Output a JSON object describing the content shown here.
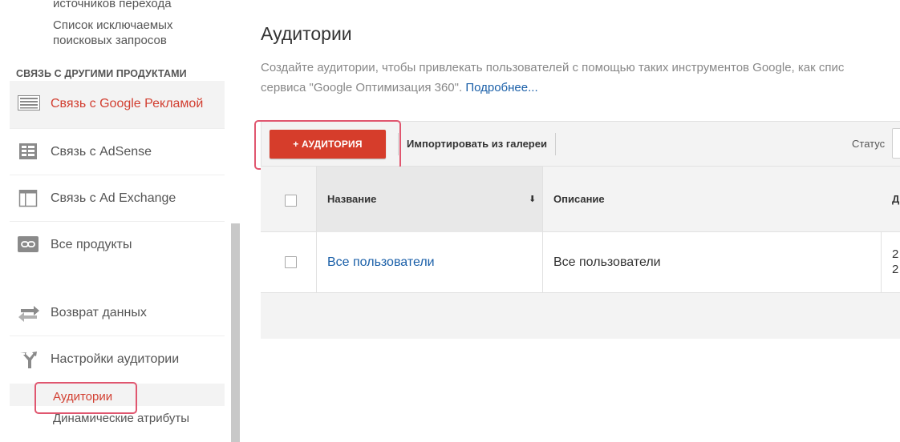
{
  "sidebar": {
    "top_cut_item": "источников перехода",
    "excluded_queries_line1": "Список исключаемых",
    "excluded_queries_line2": "поисковых запросов",
    "section_heading": "СВЯЗЬ С ДРУГИМИ ПРОДУКТАМИ",
    "items": [
      {
        "label": "Связь с Google Рекламой",
        "icon": "google-ads-icon",
        "active": true
      },
      {
        "label": "Связь с AdSense",
        "icon": "adsense-icon",
        "active": false
      },
      {
        "label": "Связь с Ad Exchange",
        "icon": "ad-exchange-icon",
        "active": false
      },
      {
        "label": "Все продукты",
        "icon": "link-icon",
        "active": false
      },
      {
        "label": "Возврат данных",
        "icon": "data-return-icon",
        "active": false
      },
      {
        "label": "Настройки аудитории",
        "icon": "audience-settings-icon",
        "active": false
      }
    ],
    "sub_audiences": "Аудитории",
    "sub_dynamic_attributes": "Динамические атрибуты"
  },
  "main": {
    "title": "Аудитории",
    "description_line1": "Создайте аудитории, чтобы привлекать пользователей с помощью таких инструментов Google, как спис",
    "description_line2": "сервиса \"Google Оптимизация 360\". ",
    "description_more": "Подробнее...",
    "toolbar": {
      "add_button": "+ АУДИТОРИЯ",
      "import_label": "Импортировать из галереи",
      "status_label": "Статус"
    },
    "table": {
      "headers": {
        "name": "Название",
        "sort_indicator": "⬇",
        "description": "Описание",
        "next_cut": "Д"
      },
      "rows": [
        {
          "name": "Все пользователи",
          "description": "Все пользователи",
          "cut_line1": "2",
          "cut_line2": "2"
        }
      ]
    }
  },
  "colors": {
    "accent_red": "#d63d2b",
    "active_label": "#d23f31",
    "link_blue": "#1a5fa8",
    "highlight_pink": "#e0566f"
  }
}
